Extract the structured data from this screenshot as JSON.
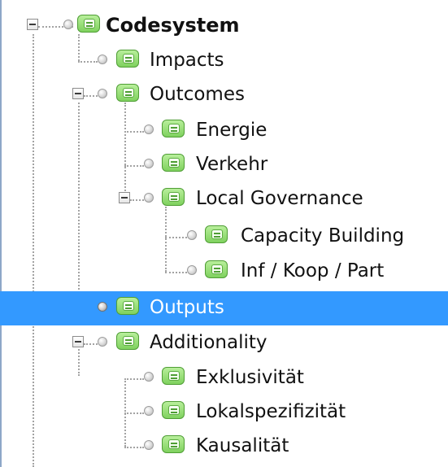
{
  "tree": {
    "root": {
      "label": "Codesystem",
      "icon": "code-icon"
    },
    "impacts": {
      "label": "Impacts"
    },
    "outcomes": {
      "label": "Outcomes"
    },
    "energie": {
      "label": "Energie"
    },
    "verkehr": {
      "label": "Verkehr"
    },
    "local_governance": {
      "label": "Local Governance"
    },
    "capacity_building": {
      "label": "Capacity Building"
    },
    "inf_koop_part": {
      "label": "Inf / Koop / Part"
    },
    "outputs": {
      "label": "Outputs",
      "selected": true
    },
    "additionality": {
      "label": "Additionality"
    },
    "exklusivitaet": {
      "label": "Exklusivität"
    },
    "lokalspezifizitaet": {
      "label": "Lokalspezifizität"
    },
    "kausalitaet": {
      "label": "Kausalität"
    }
  },
  "colors": {
    "selection": "#3399ff",
    "icon_green": "#7fd15e",
    "text": "#111111"
  }
}
